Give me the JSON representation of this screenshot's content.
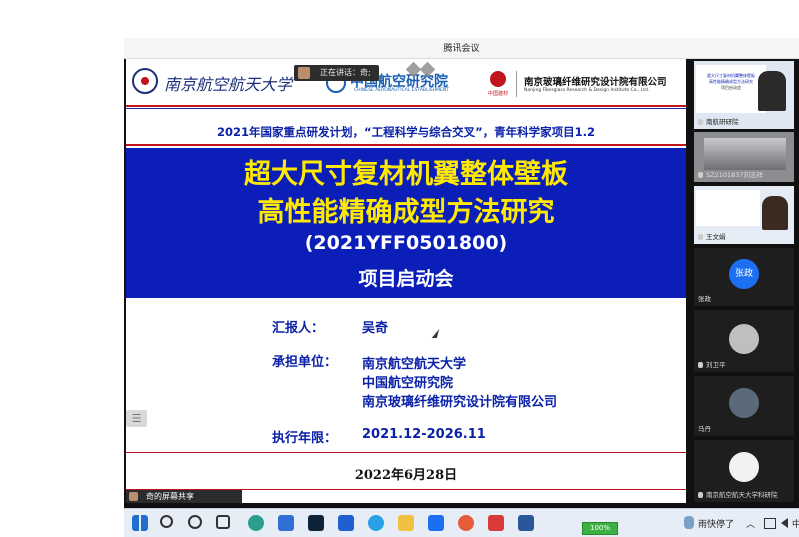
{
  "window": {
    "title": "腾讯会议"
  },
  "speaker_bar": {
    "text": "正在讲话：奇;"
  },
  "slide": {
    "logo1": "南京航空航天大学",
    "logo2_main": "中国航空研究院",
    "logo2_sub": "CHINESE AERONAUTICAL ESTABLISHMENT",
    "logo3_small": "中国建材",
    "logo4_main": "南京玻璃纤维研究设计院有限公司",
    "logo4_sub": "Nanjing Fiberglass Research & Design Institute Co., Ltd.",
    "program_line": "2021年国家重点研发计划，“工程科学与综合交叉”，青年科学家项目1.2",
    "title_line1": "超大尺寸复材机翼整体壁板",
    "title_line2": "高性能精确成型方法研究",
    "code": "(2021YFF0501800)",
    "meeting": "项目启动会",
    "reporter_label": "汇报人：",
    "reporter": "吴奇",
    "unit_label": "承担单位：",
    "units": [
      "南京航空航天大学",
      "中国航空研究院",
      "南京玻璃纤维研究设计院有限公司"
    ],
    "period_label": "执行年限：",
    "period": "2021.12-2026.11",
    "date": "2022年6月28日"
  },
  "share_bar": {
    "text": "奇的屏幕共享"
  },
  "participants": [
    {
      "name": "南航研研院",
      "kind": "video"
    },
    {
      "name": "SZ2101837刘志祥",
      "kind": "video"
    },
    {
      "name": "王文娟",
      "kind": "video"
    },
    {
      "name": "张政",
      "kind": "avatar",
      "avatar_text": "张政"
    },
    {
      "name": "刘卫平",
      "kind": "avatar"
    },
    {
      "name": "马丹",
      "kind": "avatar"
    },
    {
      "name": "南京航空航天大学科研院",
      "kind": "avatar"
    }
  ],
  "thumb_slide": {
    "line1": "超大尺寸复材机翼整体壁板",
    "line2": "高性能精确成型方法研究",
    "line3": "项目启动会"
  },
  "taskbar": {
    "battery": "100%",
    "weather": "雨快停了",
    "lang": "中",
    "icons": [
      "windows-start-icon",
      "search-icon",
      "cortana-icon",
      "task-view-icon",
      "edge-icon",
      "mail-icon",
      "photoshop-icon",
      "blue-app-icon",
      "ie-icon",
      "file-explorer-icon",
      "tencent-meeting-icon",
      "app-icon",
      "wps-icon",
      "word-icon"
    ]
  },
  "colors": {
    "band": "#0b1fb8",
    "title_yellow": "#ffe900",
    "label_blue": "#0a21a8",
    "accent_red": "#c0151e",
    "avatar_blue": "#1d6ff2"
  }
}
